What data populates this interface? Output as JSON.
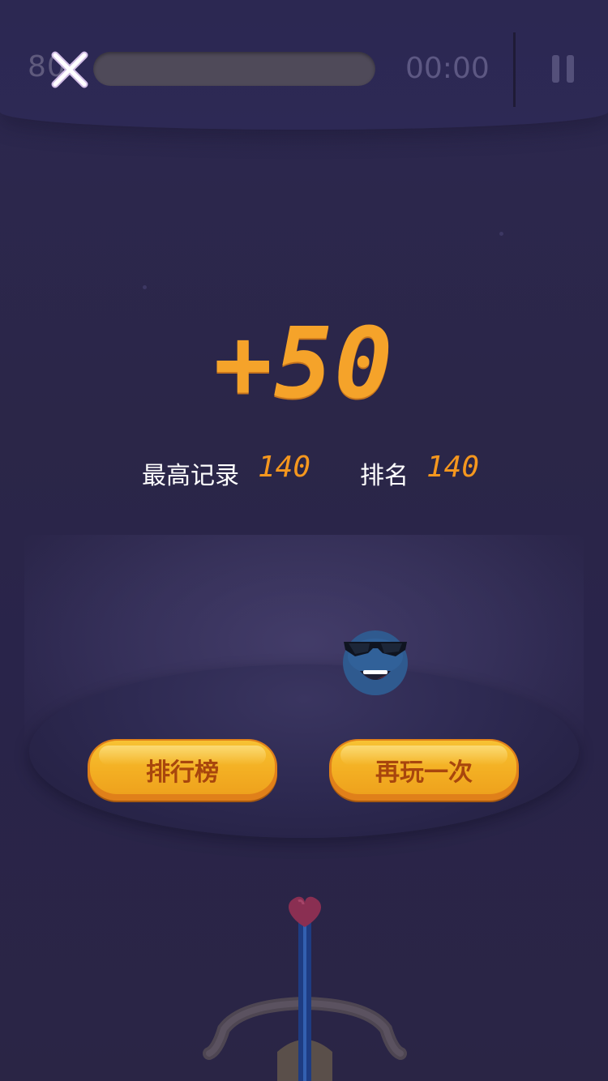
{
  "hud": {
    "score_partial": "80",
    "progress_fraction": 0,
    "timer": "00:00"
  },
  "result": {
    "score_gain": "+50",
    "best_record_label": "最高记录",
    "best_record_value": "140",
    "rank_label": "排名",
    "rank_value": "140"
  },
  "buttons": {
    "leaderboard": "排行榜",
    "play_again": "再玩一次"
  },
  "colors": {
    "background": "#2a2546",
    "accent_orange": "#f5a32a",
    "button_yellow": "#f3ae22",
    "button_text": "#a8460d"
  },
  "icons": {
    "close": "close-icon",
    "pause": "pause-icon",
    "character": "sunglasses-blob-character",
    "bow": "bow-and-arrow"
  }
}
